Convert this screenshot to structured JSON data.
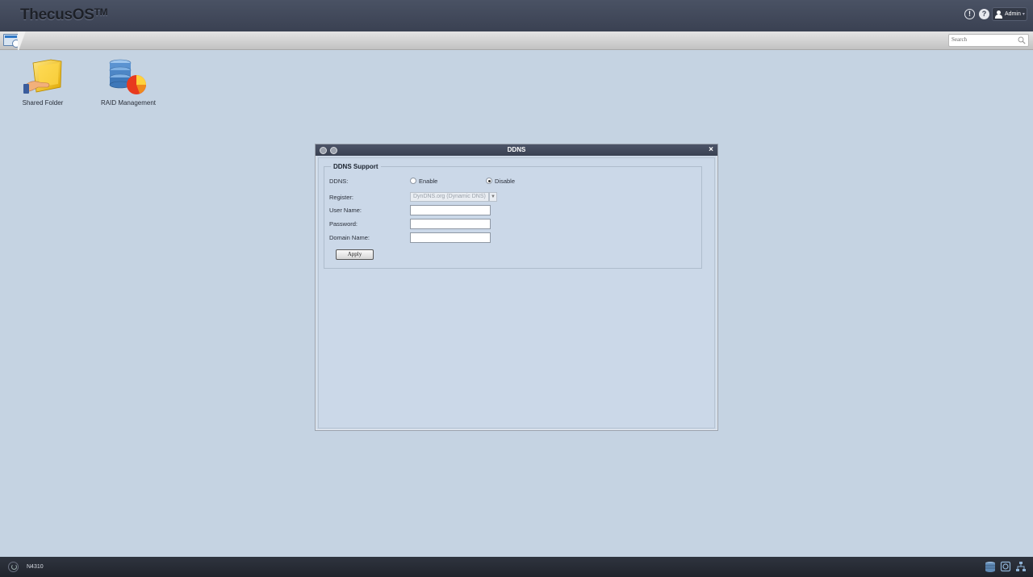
{
  "header": {
    "logo": "ThecusOS",
    "logo_tm": "TM",
    "alert_glyph": "!",
    "help_glyph": "?",
    "user_label": "Admin"
  },
  "toolbar": {
    "search_placeholder": "Search"
  },
  "desktop": {
    "icons": [
      {
        "label": "Shared Folder",
        "icon": "folder-share-icon"
      },
      {
        "label": "RAID Management",
        "icon": "raid-disk-icon"
      }
    ]
  },
  "dialog": {
    "title": "DDNS",
    "legend": "DDNS Support",
    "ddns_label": "DDNS:",
    "enable_label": "Enable",
    "disable_label": "Disable",
    "ddns_selected": "Disable",
    "register_label": "Register:",
    "register_value": "DynDNS.org (Dynamic DNS)",
    "username_label": "User Name:",
    "username_value": "",
    "password_label": "Password:",
    "password_value": "",
    "domain_label": "Domain Name:",
    "domain_value": "",
    "apply_label": "Apply"
  },
  "taskbar": {
    "device_name": "N4310",
    "tray_icons": [
      "storage-icon",
      "disk-icon",
      "network-icon"
    ]
  },
  "colors": {
    "desktop_bg": "#c5d3e2",
    "header_bg": "#3f4658",
    "dialog_bg": "#cbd8e8",
    "taskbar_bg": "#262a33"
  }
}
